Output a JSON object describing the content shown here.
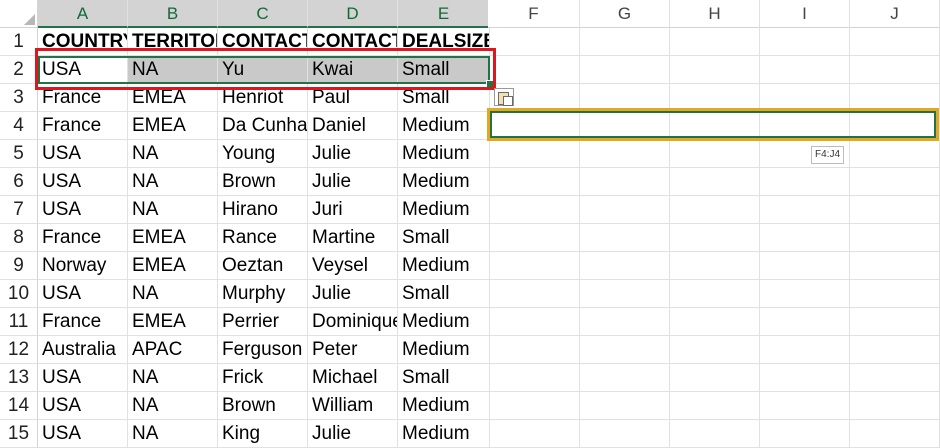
{
  "columns": [
    "A",
    "B",
    "C",
    "D",
    "E",
    "F",
    "G",
    "H",
    "I",
    "J"
  ],
  "rows": [
    "1",
    "2",
    "3",
    "4",
    "5",
    "6",
    "7",
    "8",
    "9",
    "10",
    "11",
    "12",
    "13",
    "14",
    "15"
  ],
  "header_row": [
    "COUNTRY",
    "TERRITOR",
    "CONTACT",
    "CONTACT",
    "DEALSIZE"
  ],
  "data_rows": [
    [
      "USA",
      "NA",
      "Yu",
      "Kwai",
      "Small"
    ],
    [
      "France",
      "EMEA",
      "Henriot",
      "Paul",
      "Small"
    ],
    [
      "France",
      "EMEA",
      "Da Cunha",
      "Daniel",
      "Medium"
    ],
    [
      "USA",
      "NA",
      "Young",
      "Julie",
      "Medium"
    ],
    [
      "USA",
      "NA",
      "Brown",
      "Julie",
      "Medium"
    ],
    [
      "USA",
      "NA",
      "Hirano",
      "Juri",
      "Medium"
    ],
    [
      "France",
      "EMEA",
      "Rance",
      "Martine",
      "Small"
    ],
    [
      "Norway",
      "EMEA",
      "Oeztan",
      "Veysel",
      "Medium"
    ],
    [
      "USA",
      "NA",
      "Murphy",
      "Julie",
      "Small"
    ],
    [
      "France",
      "EMEA",
      "Perrier",
      "Dominique",
      "Medium"
    ],
    [
      "Australia",
      "APAC",
      "Ferguson",
      "Peter",
      "Medium"
    ],
    [
      "USA",
      "NA",
      "Frick",
      "Michael",
      "Small"
    ],
    [
      "USA",
      "NA",
      "Brown",
      "William",
      "Medium"
    ],
    [
      "USA",
      "NA",
      "King",
      "Julie",
      "Medium"
    ]
  ],
  "paste_range_tooltip": "F4:J4",
  "colors": {
    "selection_border": "#217346",
    "highlight_box": "#e0161e",
    "paste_target_border": "#e3a81b",
    "selected_fill": "#c9c9c9"
  },
  "icons": [
    "paste-options-icon",
    "select-all-corner-icon"
  ]
}
